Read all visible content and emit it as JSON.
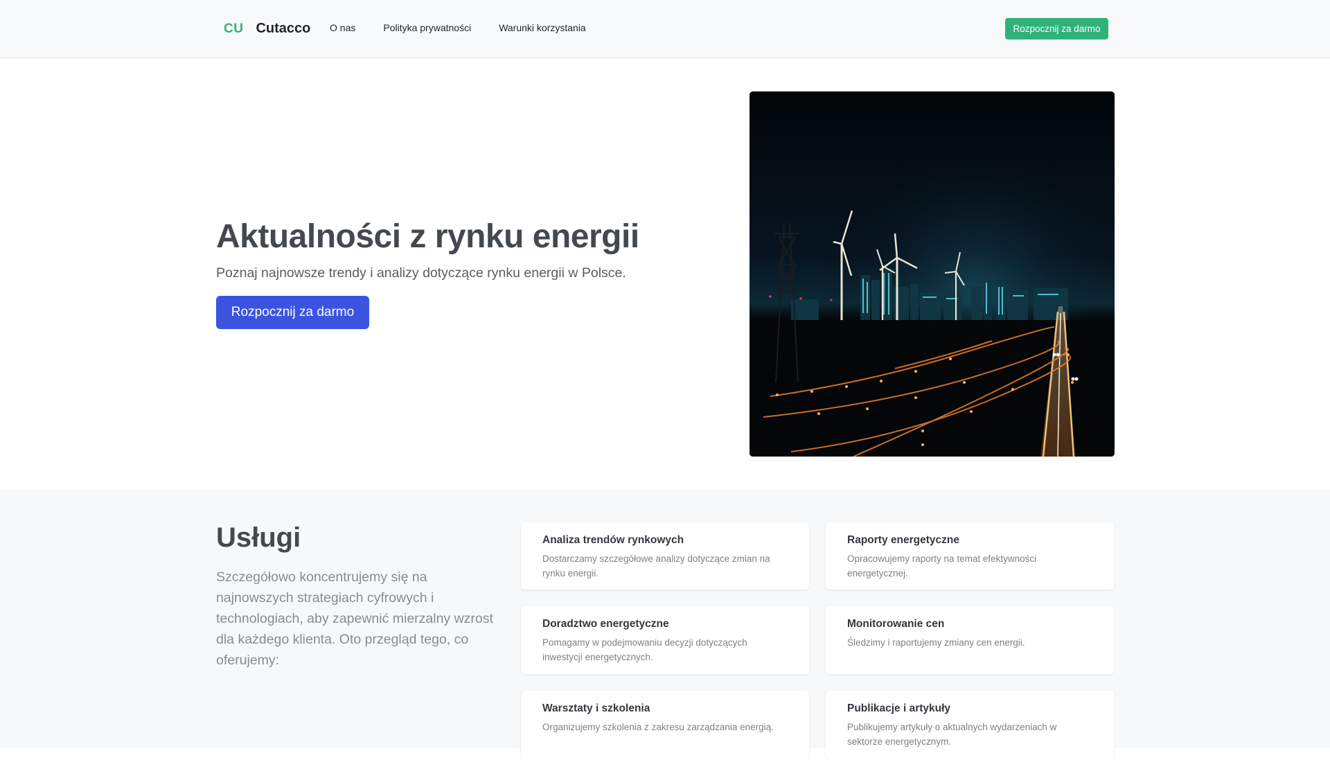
{
  "header": {
    "logo_mark": "CU",
    "brand": "Cutacco",
    "nav": [
      "O nas",
      "Polityka prywatności",
      "Warunki korzystania"
    ],
    "cta": "Rozpocznij za darmo"
  },
  "hero": {
    "title": "Aktualności z rynku energii",
    "subtitle": "Poznaj najnowsze trendy i analizy dotyczące rynku energii w Polsce.",
    "cta": "Rozpocznij za darmo"
  },
  "services": {
    "title": "Usługi",
    "description": "Szczegółowo koncentrujemy się na najnowszych strategiach cyfrowych i technologiach, aby zapewnić mierzalny wzrost dla każdego klienta. Oto przegląd tego, co oferujemy:",
    "cards": [
      {
        "title": "Analiza trendów rynkowych",
        "desc": "Dostarczamy szczegółowe analizy dotyczące zmian na rynku energii."
      },
      {
        "title": "Raporty energetyczne",
        "desc": "Opracowujemy raporty na temat efektywności energetycznej."
      },
      {
        "title": "Doradztwo energetyczne",
        "desc": "Pomagamy w podejmowaniu decyzji dotyczących inwestycji energetycznych."
      },
      {
        "title": "Monitorowanie cen",
        "desc": "Śledzimy i raportujemy zmiany cen energii."
      },
      {
        "title": "Warsztaty i szkolenia",
        "desc": "Organizujemy szkolenia z zakresu zarządzania energią."
      },
      {
        "title": "Publikacje i artykuły",
        "desc": "Publikujemy artykuły o aktualnych wydarzeniach w sektorze energetycznym."
      }
    ]
  },
  "colors": {
    "accent_green": "#2fb27a",
    "primary_blue": "#3b54e0"
  }
}
